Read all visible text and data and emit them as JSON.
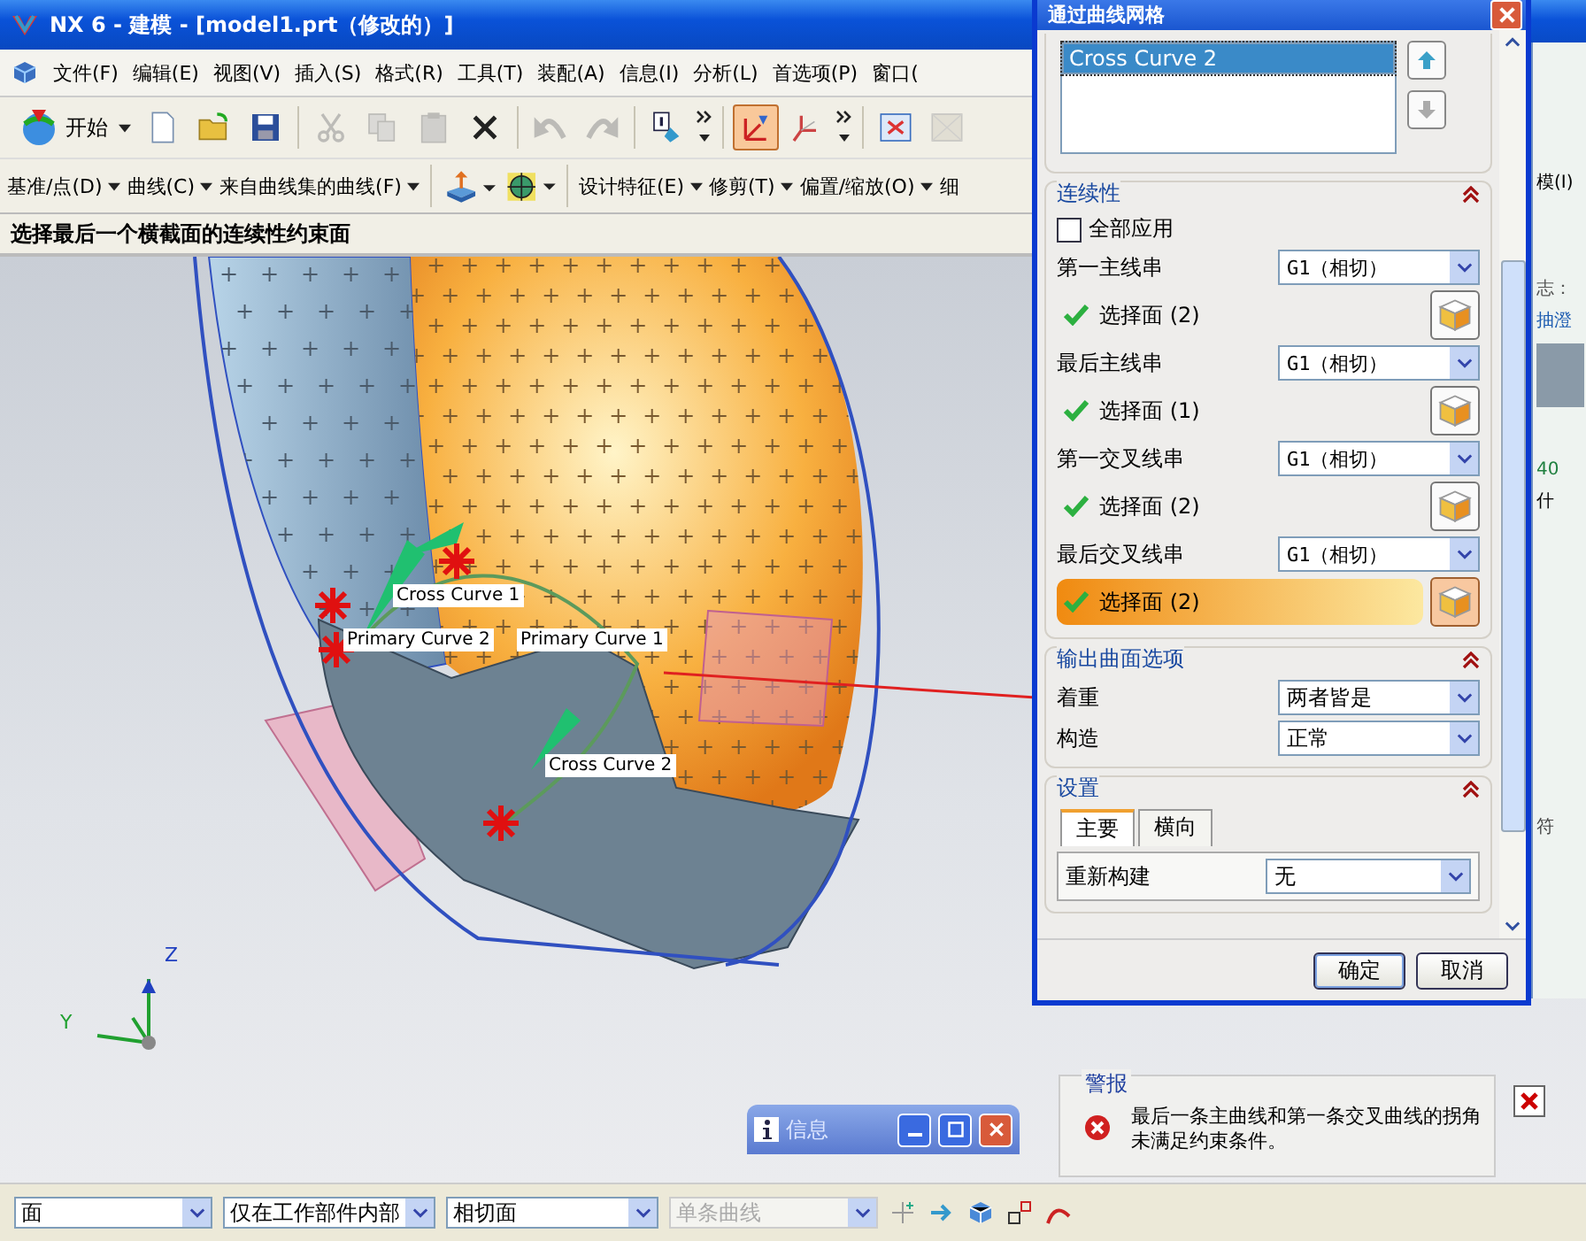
{
  "window": {
    "title": "NX 6 - 建模 - [model1.prt（修改的）]"
  },
  "menu": [
    "文件(F)",
    "编辑(E)",
    "视图(V)",
    "插入(S)",
    "格式(R)",
    "工具(T)",
    "装配(A)",
    "信息(I)",
    "分析(L)",
    "首选项(P)",
    "窗口("
  ],
  "toolbar": {
    "start_label": "开始",
    "buttons": [
      {
        "kind": "new",
        "disabled": false
      },
      {
        "kind": "open",
        "disabled": false
      },
      {
        "kind": "save",
        "disabled": false
      },
      {
        "kind": "cut",
        "disabled": true
      },
      {
        "kind": "copy",
        "disabled": true
      },
      {
        "kind": "paste",
        "disabled": true
      },
      {
        "kind": "delete",
        "disabled": false
      },
      {
        "kind": "undo",
        "disabled": true
      },
      {
        "kind": "redo",
        "disabled": true
      },
      {
        "kind": "info",
        "disabled": false
      },
      {
        "kind": "wcs",
        "disabled": false,
        "selected": true
      },
      {
        "kind": "csys",
        "disabled": false,
        "selected": false
      },
      {
        "kind": "fit",
        "disabled": false
      },
      {
        "kind": "shade",
        "disabled": true
      }
    ]
  },
  "feature_toolbar": [
    {
      "kind": "menu",
      "label": "基准/点(D)"
    },
    {
      "kind": "menu",
      "label": "曲线(C)"
    },
    {
      "kind": "menu",
      "label": "来自曲线集的曲线(F)"
    },
    {
      "kind": "extrude"
    },
    {
      "kind": "section"
    },
    {
      "kind": "menu",
      "label": "设计特征(E)"
    },
    {
      "kind": "menu",
      "label": "修剪(T)"
    },
    {
      "kind": "menu",
      "label": "偏置/缩放(O)"
    },
    {
      "kind": "text",
      "label": "细"
    }
  ],
  "cue_line": "选择最后一个横截面的连续性约束面",
  "viewport": {
    "curve_labels": [
      "Cross Curve  1",
      "Primary Curve  2",
      "Primary Curve  1",
      "Cross Curve  2"
    ],
    "axes": [
      "Z",
      "Y"
    ]
  },
  "dialog": {
    "title": "通过曲线网格",
    "list": [
      {
        "text": "Cross Curve  2",
        "selected": true
      }
    ],
    "continuity": {
      "title": "连续性",
      "expanded": true,
      "apply_all": {
        "label": "全部应用",
        "checked": false
      },
      "rows": [
        {
          "label": "第一主线串",
          "value": "G1（相切）",
          "face": "选择面 (2)",
          "active": false
        },
        {
          "label": "最后主线串",
          "value": "G1（相切）",
          "face": "选择面 (1)",
          "active": false
        },
        {
          "label": "第一交叉线串",
          "value": "G1（相切）",
          "face": "选择面 (2)",
          "active": false
        },
        {
          "label": "最后交叉线串",
          "value": "G1（相切）",
          "face": "选择面 (2)",
          "active": true
        }
      ]
    },
    "output": {
      "title": "输出曲面选项",
      "expanded": true,
      "fields": [
        {
          "label": "着重",
          "value": "两者皆是"
        },
        {
          "label": "构造",
          "value": "正常"
        }
      ]
    },
    "settings": {
      "title": "设置",
      "expanded": true,
      "tabs": [
        {
          "label": "主要",
          "selected": true
        },
        {
          "label": "横向",
          "selected": false
        }
      ],
      "field": {
        "label": "重新构建",
        "value": "无"
      }
    },
    "buttons": [
      "确定",
      "取消"
    ]
  },
  "background_window": {
    "fragments": [
      "模(I)",
      "志：",
      "抽澄",
      "40",
      "什",
      "符"
    ]
  },
  "info_window": {
    "title": "信息"
  },
  "alert": {
    "title": "警报",
    "message": "最后一条主曲线和第一条交叉曲线的拐角未满足约束条件。"
  },
  "selection_bar": [
    {
      "value": "面",
      "disabled": false
    },
    {
      "value": "仅在工作部件内部",
      "disabled": false
    },
    {
      "value": "相切面",
      "disabled": false
    },
    {
      "value": "单条曲线",
      "disabled": true
    }
  ]
}
